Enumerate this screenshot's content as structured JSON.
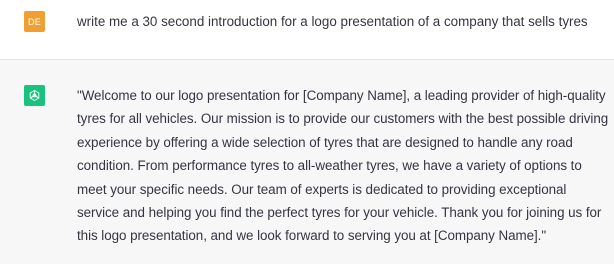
{
  "conversation": {
    "user_message": {
      "avatar_initials": "DE",
      "avatar_color": "#f0a033",
      "text": "write me a 30 second introduction for a logo presentation of a company that sells tyres"
    },
    "assistant_message": {
      "avatar_icon": "openai-logo-icon",
      "avatar_color": "#19c37d",
      "text": "\"Welcome to our logo presentation for [Company Name], a leading provider of high-quality tyres for all vehicles. Our mission is to provide our customers with the best possible driving experience by offering a wide selection of tyres that are designed to handle any road condition. From performance tyres to all-weather tyres, we have a variety of options to meet your specific needs. Our team of experts is dedicated to providing exceptional service and helping you find the perfect tyres for your vehicle. Thank you for joining us for this logo presentation, and we look forward to serving you at [Company Name].\""
    }
  }
}
